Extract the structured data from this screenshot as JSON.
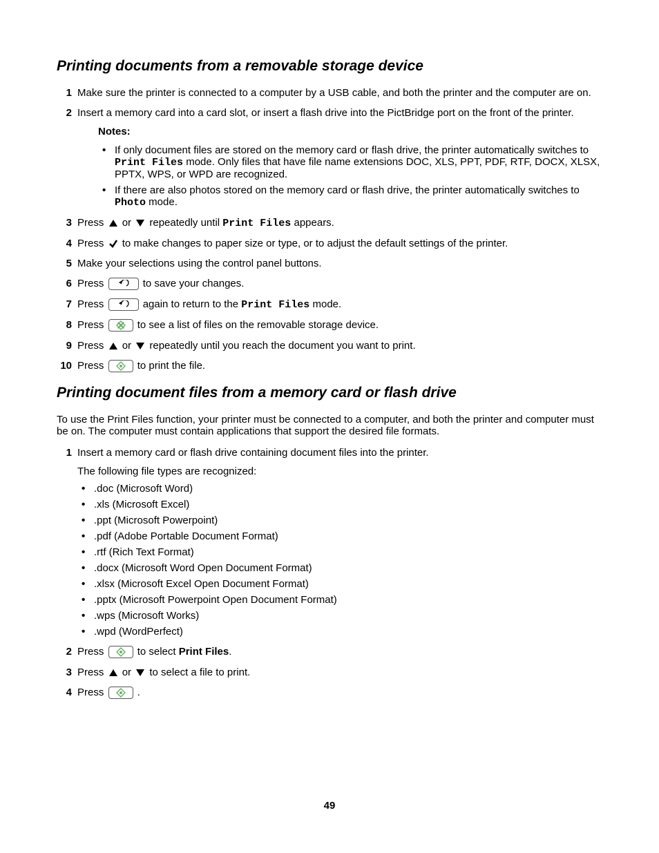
{
  "section1": {
    "title": "Printing documents from a removable storage device",
    "steps": {
      "s1": "Make sure the printer is connected to a computer by a USB cable, and both the printer and the computer are on.",
      "s2": "Insert a memory card into a card slot, or insert a flash drive into the PictBridge port on the front of the printer.",
      "notes_label": "Notes:",
      "note1_a": "If only document files are stored on the memory card or flash drive, the printer automatically switches to ",
      "note1_mode": "Print Files",
      "note1_b": " mode. Only files that have file name extensions DOC, XLS, PPT, PDF, RTF, DOCX, XLSX, PPTX, WPS, or WPD are recognized.",
      "note2_a": "If there are also photos stored on the memory card or flash drive, the printer automatically switches to ",
      "note2_mode": "Photo",
      "note2_b": " mode.",
      "s3_a": "Press ",
      "s3_b": " or ",
      "s3_c": " repeatedly until ",
      "s3_mode": "Print Files",
      "s3_d": " appears.",
      "s4_a": "Press ",
      "s4_b": " to make changes to paper size or type, or to adjust the default settings of the printer.",
      "s5": "Make your selections using the control panel buttons.",
      "s6_a": "Press ",
      "s6_b": " to save your changes.",
      "s7_a": "Press ",
      "s7_b": " again to return to the ",
      "s7_mode": "Print Files",
      "s7_c": " mode.",
      "s8_a": "Press ",
      "s8_b": " to see a list of files on the removable storage device.",
      "s9_a": "Press ",
      "s9_b": " or ",
      "s9_c": " repeatedly until you reach the document you want to print.",
      "s10_a": "Press ",
      "s10_b": " to print the file."
    }
  },
  "section2": {
    "title": "Printing document files from a memory card or flash drive",
    "intro": "To use the Print Files function, your printer must be connected to a computer, and both the printer and computer must be on. The computer must contain applications that support the desired file formats.",
    "steps": {
      "s1": "Insert a memory card or flash drive containing document files into the printer.",
      "s1_sub": "The following file types are recognized:",
      "filetypes": {
        "ft0": ".doc (Microsoft Word)",
        "ft1": ".xls (Microsoft Excel)",
        "ft2": ".ppt (Microsoft Powerpoint)",
        "ft3": ".pdf (Adobe Portable Document Format)",
        "ft4": ".rtf (Rich Text Format)",
        "ft5": ".docx (Microsoft Word Open Document Format)",
        "ft6": ".xlsx (Microsoft Excel Open Document Format)",
        "ft7": ".pptx (Microsoft Powerpoint Open Document Format)",
        "ft8": ".wps (Microsoft Works)",
        "ft9": ".wpd (WordPerfect)"
      },
      "s2_a": "Press ",
      "s2_b": " to select ",
      "s2_bold": "Print Files",
      "s2_c": ".",
      "s3_a": "Press ",
      "s3_b": " or ",
      "s3_c": " to select a file to print.",
      "s4_a": "Press ",
      "s4_b": "."
    }
  },
  "page_number": "49"
}
